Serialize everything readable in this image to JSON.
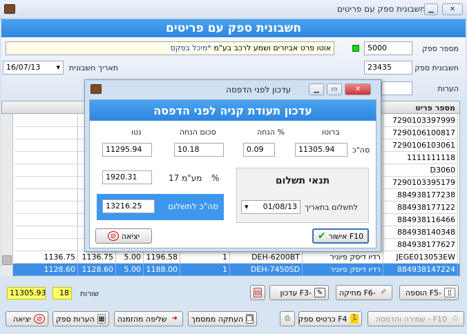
{
  "window": {
    "title": "חשבונית ספק עם פריטים"
  },
  "banner": "חשבונית ספק עם פריטים",
  "header": {
    "supplier_number_label": "מספר ספק",
    "supplier_number": "5000",
    "supplier_name": "אוטו פרט  אביזרים ושמע לרכב  בע\"מ",
    "supplier_name_note": "*מיכל בפקס",
    "invoice_number_label": "חשבונית ספק",
    "invoice_number": "23435",
    "invoice_date_label": "תאריך חשבונית",
    "invoice_date": "16/07/13",
    "notes_label": "הערות"
  },
  "grid": {
    "col_item_number": "מספר פריט",
    "rows": [
      {
        "item": "7290103397999"
      },
      {
        "item": "7290106100817"
      },
      {
        "item": "7290106103061"
      },
      {
        "item": "1111111118"
      },
      {
        "item": "D3060"
      },
      {
        "item": "7290103395179"
      },
      {
        "item": "884938177238"
      },
      {
        "item": "884938177122"
      },
      {
        "item": "884938116466"
      },
      {
        "item": "884938140348"
      },
      {
        "item": "884938177627"
      },
      {
        "item": "JEGE013053EW",
        "name": "רדיו דיסק פיוניר",
        "model": "DEH-6200BT",
        "qty": "1",
        "price": "1196.58",
        "disc": "5.00",
        "net": "1136.75",
        "total": "1136.75"
      },
      {
        "item": "884938147224",
        "name": "רדיו דיסק פיוניר",
        "model": "DEH-7450SD",
        "qty": "1",
        "price": "1188.00",
        "disc": "5.00",
        "net": "1128.60",
        "total": "1128.60"
      }
    ]
  },
  "dialog": {
    "title": "עדכון לפני הדפסה",
    "banner": "עדכון תעודת קניה לפני הדפסה",
    "gross_label": "ברוטו",
    "disc_pct_label": "% הנחה",
    "disc_amount_label": "סכום הנחה",
    "net_label": "נטו",
    "total_label": "סה\"כ",
    "gross": "11305.94",
    "disc_pct": "0.09",
    "disc_amount": "10.18",
    "net": "11295.94",
    "vat_pct_label": "%",
    "vat_rate": "17",
    "vat_label": "מע\"מ",
    "vat": "1920.31",
    "pay_total_label": "סה\"כ לתשלום",
    "pay_total": "13216.25",
    "terms_title": "תנאי תשלום",
    "pay_date_label": "לתשלום בתאריך",
    "pay_date": "01/08/13",
    "ok_label": "אישור F10",
    "exit_label": "יציאה"
  },
  "footer": {
    "total": "11305.93",
    "rows_count": "18",
    "rows_label": "שורות",
    "add_label": "הוספה F5-",
    "delete_label": "מחיקה F6-",
    "update_label": "עדכון F3-",
    "exit_label": "יציאה",
    "notes_label": "הערות ספק",
    "fetch_order_label": "שליפה מהזמנה",
    "copy_doc_label": "העתקה ממסמך",
    "supplier_card_label": "כרטיס ספק F4",
    "save_print_label": "שמירה והדפסה - F10"
  }
}
